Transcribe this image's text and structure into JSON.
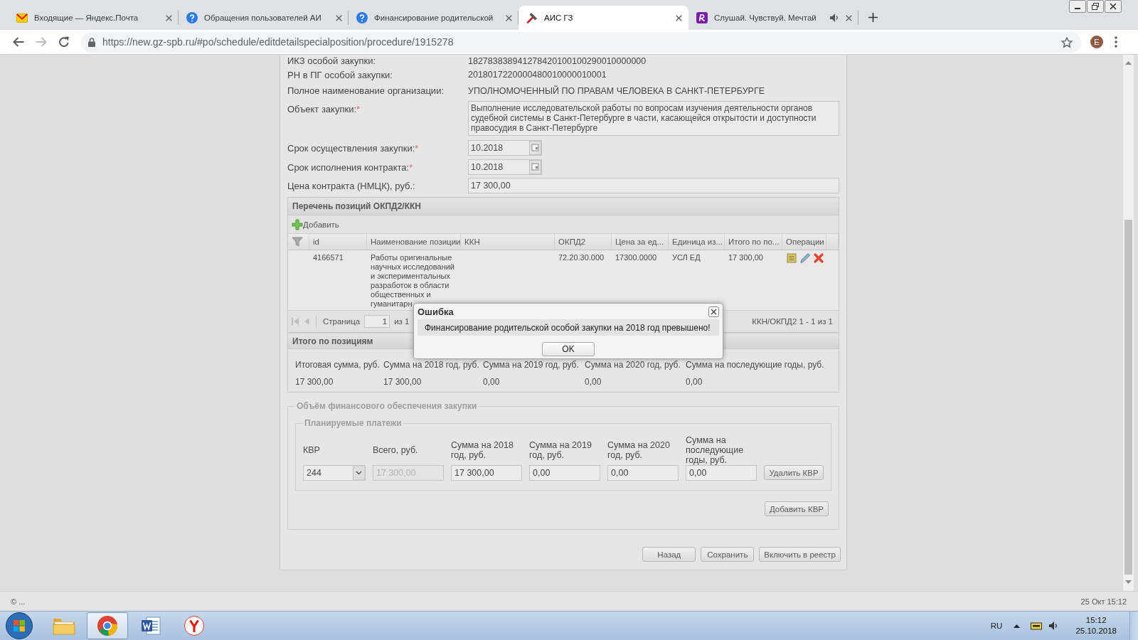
{
  "browser": {
    "tabs": [
      {
        "kind": "mail",
        "title": "Входящие — Яндекс.Почта",
        "selected": false,
        "audio": false
      },
      {
        "kind": "help",
        "title": "Обращения пользователей АИ",
        "selected": false,
        "audio": false
      },
      {
        "kind": "help",
        "title": "Финансирование родительской",
        "selected": false,
        "audio": false
      },
      {
        "kind": "tool",
        "title": "АИС ГЗ",
        "selected": true,
        "audio": false
      },
      {
        "kind": "app",
        "title": "Слушай. Чувствуй. Мечтай",
        "selected": false,
        "audio": true
      }
    ],
    "forward_disabled": true,
    "url": "https://new.gz-spb.ru/#po/schedule/editdetailspecialposition/procedure/1915278",
    "profile_initial": "E"
  },
  "form": {
    "fields": [
      {
        "kind": "text",
        "label": "ИКЗ особой закупки:",
        "value": "182783838941278420100100290010000000"
      },
      {
        "kind": "text",
        "label": "РН в ПГ особой закупки:",
        "value": "2018017220000480010000010001"
      },
      {
        "kind": "text",
        "label": "Полное наименование организации:",
        "value": "УПОЛНОМОЧЕННЫЙ ПО ПРАВАМ ЧЕЛОВЕКА В САНКТ-ПЕТЕРБУРГЕ"
      },
      {
        "kind": "textarea",
        "label": "Объект закупки:",
        "required_mark": "*",
        "value": "Выполнение исследовательской работы по вопросам изучения деятельности органов судебной системы в Санкт-Петербурге в части, касающейся открытости и доступности правосудия в Санкт-Петербурге"
      },
      {
        "kind": "date",
        "label": "Срок осуществления закупки:",
        "required_mark": "*",
        "value": "10.2018"
      },
      {
        "kind": "date",
        "label": "Срок исполнения контракта:",
        "required_mark": "*",
        "value": "10.2018"
      },
      {
        "kind": "input",
        "label": "Цена контракта (НМЦК), руб.:",
        "value": "17 300,00"
      }
    ]
  },
  "positions": {
    "title": "Перечень позиций ОКПД2/ККН",
    "add_button": "Добавить",
    "columns": [
      "id",
      "Наименование позиции",
      "ККН",
      "ОКПД2",
      "Цена за ед...",
      "Единица из...",
      "Итого по по...",
      "Операции"
    ],
    "rows": [
      {
        "id": "4166571",
        "name": "Работы оригинальные научных исследований и экспериментальных разработок в области общественных и гуманитарн",
        "okpd2": "72.20.30.000",
        "price": "17300.0000",
        "unit": "УСЛ ЕД",
        "total": "17 300,00"
      }
    ],
    "pager": {
      "nav_disabled": true,
      "page_label": "Страница",
      "page": "1",
      "page_count": "из 1",
      "summary": "ККН/ОКПД2 1 - 1 из 1"
    }
  },
  "totals": {
    "title": "Итого по позициям",
    "columns": [
      {
        "label": "Итоговая сумма, руб.",
        "value": "17 300,00"
      },
      {
        "label": "Сумма на 2018 год, руб.",
        "value": "17 300,00"
      },
      {
        "label": "Сумма на 2019 год, руб.",
        "value": "0,00"
      },
      {
        "label": "Сумма на 2020 год, руб.",
        "value": "0,00"
      },
      {
        "label": "Сумма на последующие годы, руб.",
        "value": "0,00"
      }
    ]
  },
  "financing": {
    "title": "Объём финансового обеспечения закупки",
    "payments": {
      "title": "Планируемые платежи",
      "columns": [
        {
          "kind": "select",
          "label": "КВР",
          "value": "244",
          "disabled": false
        },
        {
          "kind": "input",
          "label": "Всего, руб.",
          "value": "17 300,00",
          "disabled": true
        },
        {
          "kind": "input",
          "label": "Сумма на 2018 год, руб.",
          "value": "17 300,00",
          "disabled": false
        },
        {
          "kind": "input",
          "label": "Сумма на 2019 год, руб.",
          "value": "0,00",
          "disabled": false
        },
        {
          "kind": "input",
          "label": "Сумма на 2020 год, руб.",
          "value": "0,00",
          "disabled": false
        },
        {
          "kind": "input",
          "label": "Сумма на последующие годы, руб.",
          "value": "0,00",
          "disabled": false
        }
      ],
      "remove_button": "Удалить КВР"
    },
    "add_button": "Добавить КВР"
  },
  "actions": [
    "Назад",
    "Сохранить",
    "Включить в реестр"
  ],
  "footer": {
    "copyright": "© ...",
    "timestamp": "25 Окт 15:12"
  },
  "dialog": {
    "title": "Ошибка",
    "message": "Финансирование родительской особой закупки на 2018 год превышено!",
    "button": "OK"
  },
  "taskbar": {
    "apps": [
      {
        "kind": "folder",
        "selected": false
      },
      {
        "kind": "browser",
        "selected": true
      },
      {
        "kind": "document",
        "selected": false
      },
      {
        "kind": "circle-logo",
        "selected": false
      }
    ],
    "language": "RU",
    "time": "15:12",
    "date": "25.10.2018"
  }
}
